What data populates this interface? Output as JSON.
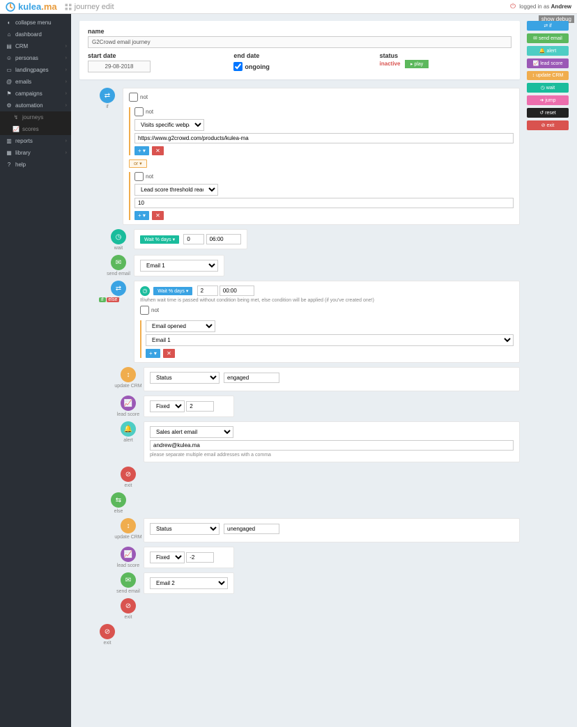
{
  "brand": {
    "part1": "kulea",
    "part2": ".ma"
  },
  "page_title": "journey edit",
  "user_prefix": "logged in as",
  "user_name": "Andrew",
  "show_debug": "show debug",
  "sidebar": {
    "collapse": "collapse menu",
    "items": [
      {
        "label": "dashboard",
        "chev": false
      },
      {
        "label": "CRM",
        "chev": true
      },
      {
        "label": "personas",
        "chev": true
      },
      {
        "label": "landingpages",
        "chev": true
      },
      {
        "label": "emails",
        "chev": true
      },
      {
        "label": "campaigns",
        "chev": true
      },
      {
        "label": "automation",
        "chev": true
      }
    ],
    "sub": [
      {
        "label": "journeys"
      },
      {
        "label": "scores"
      }
    ],
    "items2": [
      {
        "label": "reports",
        "chev": true
      },
      {
        "label": "library",
        "chev": true
      },
      {
        "label": "help"
      }
    ]
  },
  "form": {
    "name_label": "name",
    "name_value": "G2Crowd email journey",
    "start_label": "start date",
    "start_value": "29-08-2018",
    "end_label": "end date",
    "ongoing_label": "ongoing",
    "status_label": "status",
    "status_value": "inactive",
    "play_label": "play"
  },
  "actions": [
    {
      "label": "if",
      "color": "c-blue"
    },
    {
      "label": "send email",
      "color": "c-green"
    },
    {
      "label": "alert",
      "color": "c-cyan"
    },
    {
      "label": "lead score",
      "color": "c-purple"
    },
    {
      "label": "update CRM",
      "color": "c-orange"
    },
    {
      "label": "wait",
      "color": "c-teal"
    },
    {
      "label": "jump",
      "color": "c-pink"
    },
    {
      "label": "reset",
      "color": "c-dark"
    },
    {
      "label": "exit",
      "color": "c-red"
    }
  ],
  "steps": {
    "if1": {
      "label": "if",
      "not": "not",
      "cond1_type": "Visits specific webpage",
      "cond1_url": "https://www.g2crowd.com/products/kulea-ma",
      "or": "or",
      "cond2_type": "Lead score threshold reached",
      "cond2_val": "10"
    },
    "wait1": {
      "label": "wait",
      "pill": "Wait % days",
      "days": "0",
      "time": "06:00"
    },
    "email1": {
      "label": "send email",
      "select": "Email 1"
    },
    "if2": {
      "label": "if",
      "pill": "Wait % days",
      "days": "2",
      "time": "00:00",
      "help": "If/when wait time is passed without condition being met, else condition will be applied (if you've created one!)",
      "not": "not",
      "cond_type": "Email opened",
      "cond_email": "Email 1"
    },
    "update1": {
      "label": "update CRM",
      "field": "Status",
      "value": "engaged"
    },
    "score1": {
      "label": "lead score",
      "type": "Fixed",
      "value": "2"
    },
    "alert1": {
      "label": "alert",
      "type": "Sales alert email",
      "email": "andrew@kulea.ma",
      "help": "please separate multiple email addresses with a comma"
    },
    "exit1": {
      "label": "exit"
    },
    "else": {
      "label": "else"
    },
    "update2": {
      "label": "update CRM",
      "field": "Status",
      "value": "unengaged"
    },
    "score2": {
      "label": "lead score",
      "type": "Fixed",
      "value": "-2"
    },
    "email2": {
      "label": "send email",
      "select": "Email 2"
    },
    "exit2": {
      "label": "exit"
    },
    "exit3": {
      "label": "exit"
    }
  }
}
